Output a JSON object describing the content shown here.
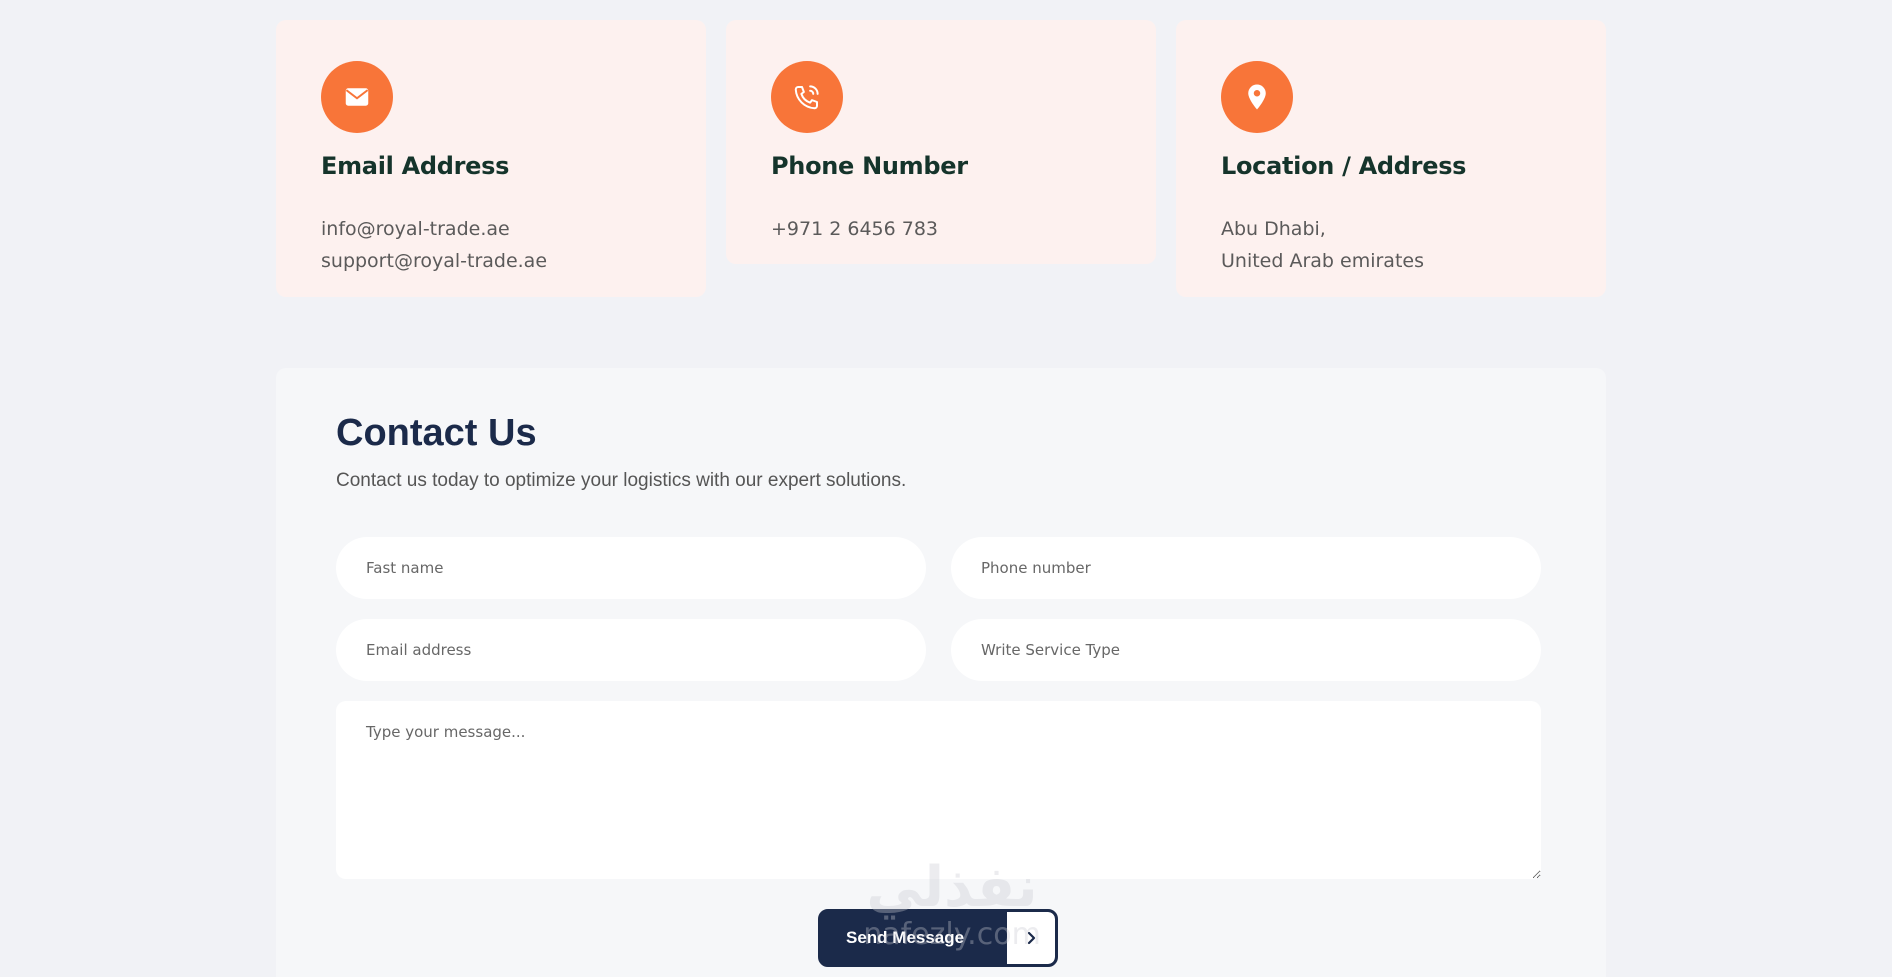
{
  "cards": [
    {
      "title": "Email Address",
      "lines": [
        "info@royal-trade.ae",
        "support@royal-trade.ae"
      ],
      "icon": "mail-icon"
    },
    {
      "title": "Phone Number",
      "lines": [
        "+971 2 6456 783"
      ],
      "icon": "phone-icon"
    },
    {
      "title": "Location / Address",
      "lines": [
        "Abu Dhabi,",
        "United Arab emirates"
      ],
      "icon": "location-pin-icon"
    }
  ],
  "contact": {
    "title": "Contact Us",
    "subtitle": "Contact us today to optimize your logistics with our expert solutions.",
    "first_name_placeholder": "Fast name",
    "phone_placeholder": "Phone number",
    "email_placeholder": "Email address",
    "service_placeholder": "Write Service Type",
    "message_placeholder": "Type your message...",
    "send_label": "Send Message"
  },
  "watermark": {
    "arabic": "نفذلي",
    "latin": "nafezly.com"
  },
  "colors": {
    "accent": "#f87539",
    "navy": "#1b2a4a",
    "card_bg": "#fdf1ef",
    "heading": "#15342b"
  }
}
